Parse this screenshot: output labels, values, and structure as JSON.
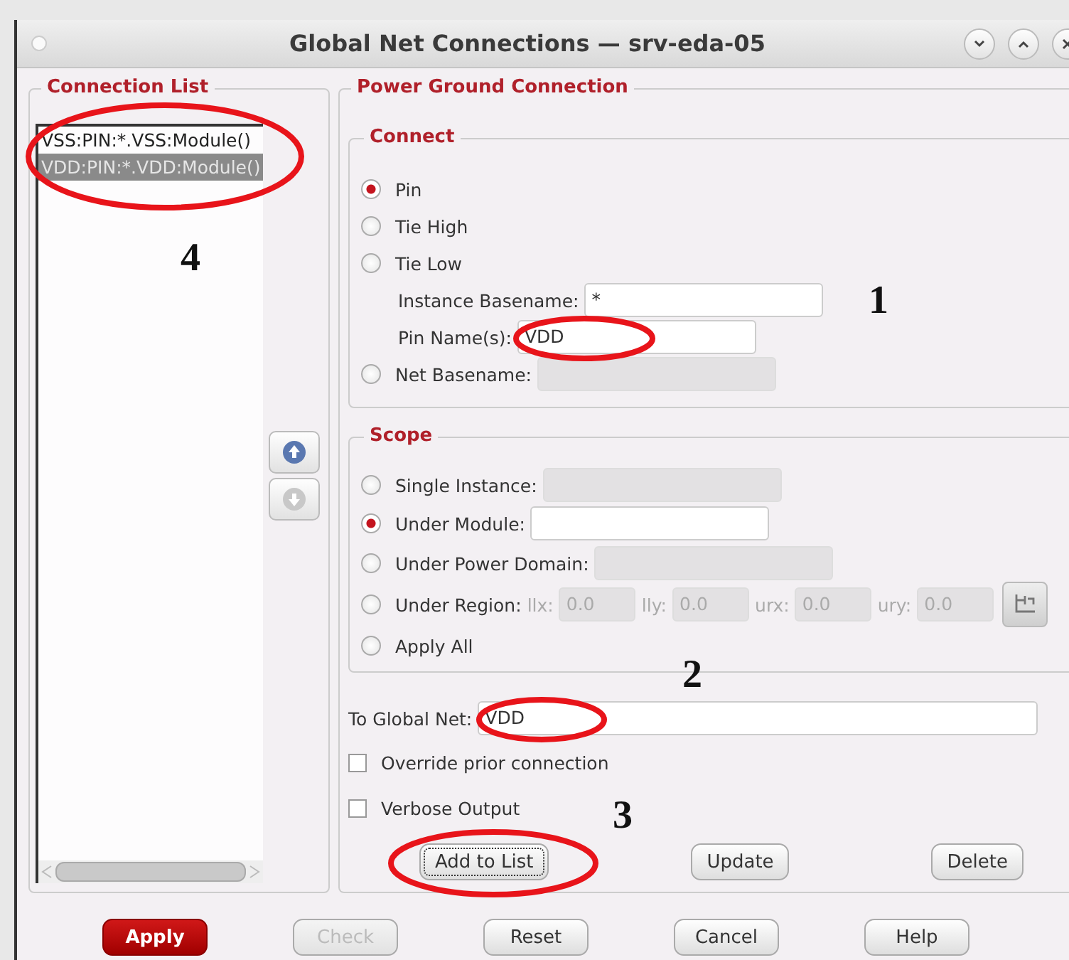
{
  "window": {
    "title": "Global Net Connections — srv-eda-05"
  },
  "connection_list": {
    "title": "Connection List",
    "items": [
      {
        "text": "VSS:PIN:*.VSS:Module()",
        "selected": false
      },
      {
        "text": "VDD:PIN:*.VDD:Module()",
        "selected": true
      }
    ]
  },
  "power_ground": {
    "title": "Power Ground Connection",
    "connect": {
      "title": "Connect",
      "rows": [
        {
          "kind": "radio",
          "label": "Pin",
          "selected": true
        },
        {
          "kind": "radio",
          "label": "Tie High",
          "selected": false
        },
        {
          "kind": "radio",
          "label": "Tie Low",
          "selected": false
        },
        {
          "kind": "field",
          "label": "Instance Basename:",
          "value": "*"
        },
        {
          "kind": "field",
          "label": "Pin Name(s):",
          "value": "VDD"
        },
        {
          "kind": "radio",
          "label": "Net Basename:",
          "selected": false,
          "field": {
            "disabled": true
          }
        }
      ]
    },
    "scope": {
      "title": "Scope",
      "rows": [
        {
          "kind": "radio",
          "label": "Single Instance:",
          "selected": false,
          "field": {
            "disabled": true
          }
        },
        {
          "kind": "radio",
          "label": "Under Module:",
          "selected": true,
          "field": {
            "disabled": false
          }
        },
        {
          "kind": "radio",
          "label": "Under Power Domain:",
          "selected": false,
          "field": {
            "disabled": true
          }
        },
        {
          "kind": "region",
          "label": "Under Region:",
          "selected": false,
          "coords": [
            {
              "label": "llx:",
              "value": "0.0"
            },
            {
              "label": "lly:",
              "value": "0.0"
            },
            {
              "label": "urx:",
              "value": "0.0"
            },
            {
              "label": "ury:",
              "value": "0.0"
            }
          ]
        },
        {
          "kind": "radio",
          "label": "Apply All",
          "selected": false
        }
      ]
    },
    "global_net": {
      "label": "To Global Net:",
      "value": "VDD"
    },
    "options": [
      {
        "label": "Override prior connection",
        "checked": false
      },
      {
        "label": "Verbose Output",
        "checked": false
      }
    ],
    "actions": [
      {
        "label": "Add to List",
        "focused": true
      },
      {
        "label": "Update",
        "focused": false
      },
      {
        "label": "Delete",
        "focused": false
      }
    ]
  },
  "footer": [
    {
      "label": "Apply",
      "kind": "primary"
    },
    {
      "label": "Check",
      "kind": "disabled"
    },
    {
      "label": "Reset",
      "kind": "normal"
    },
    {
      "label": "Cancel",
      "kind": "normal"
    },
    {
      "label": "Help",
      "kind": "normal"
    }
  ],
  "annotations": [
    {
      "number": "1"
    },
    {
      "number": "2"
    },
    {
      "number": "3"
    },
    {
      "number": "4"
    }
  ]
}
